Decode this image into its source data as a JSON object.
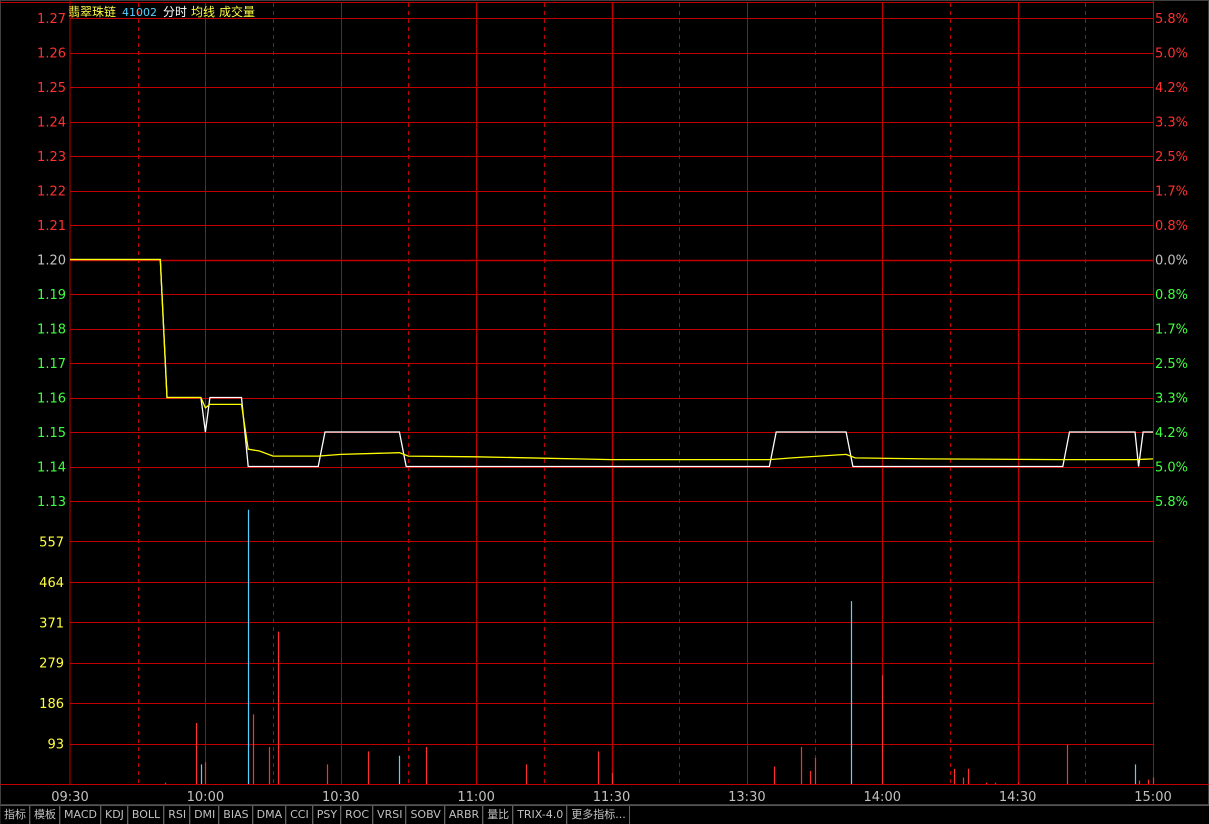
{
  "header": {
    "stock_name": "翡翠珠链",
    "stock_code": "41002",
    "label_timeshare": "分时",
    "label_avg": "均线",
    "label_volume": "成交量"
  },
  "colors": {
    "grid": "#c00000",
    "up": "#ff3030",
    "down": "#40ff40",
    "price_line": "#ffffff",
    "avg_line": "#ffff00",
    "vol_up": "#ff3030",
    "vol_down": "#54d2ff",
    "vol_label": "#ffff40",
    "axis_text": "#c0c0c0"
  },
  "tabs": [
    "指标",
    "模板",
    "MACD",
    "KDJ",
    "BOLL",
    "RSI",
    "DMI",
    "BIAS",
    "DMA",
    "CCI",
    "PSY",
    "ROC",
    "VRSI",
    "SOBV",
    "ARBR",
    "量比",
    "TRIX-4.0",
    "更多指标..."
  ],
  "chart_data": {
    "type": "line",
    "prev_close": 1.2,
    "price_axis": {
      "ticks": [
        "1.27",
        "1.26",
        "1.25",
        "1.24",
        "1.23",
        "1.22",
        "1.21",
        "1.20",
        "1.19",
        "1.18",
        "1.17",
        "1.16",
        "1.15",
        "1.14",
        "1.13"
      ],
      "ylim": [
        1.13,
        1.27
      ]
    },
    "pct_axis": {
      "ticks": [
        "5.8%",
        "5.0%",
        "4.2%",
        "3.3%",
        "2.5%",
        "1.7%",
        "0.8%",
        "0.0%",
        "0.8%",
        "1.7%",
        "2.5%",
        "3.3%",
        "4.2%",
        "5.0%",
        "5.8%"
      ]
    },
    "volume_axis": {
      "ticks": [
        "557",
        "464",
        "371",
        "279",
        "186",
        "93"
      ],
      "ylim": [
        0,
        650
      ]
    },
    "x_ticks": [
      "09:30",
      "10:00",
      "10:30",
      "11:00",
      "11:30",
      "13:30",
      "14:00",
      "14:30",
      "15:00"
    ],
    "x_range_minutes": [
      0,
      240
    ],
    "series": [
      {
        "role": "price",
        "points": [
          [
            0,
            1.2
          ],
          [
            20,
            1.2
          ],
          [
            21.5,
            1.16
          ],
          [
            29,
            1.16
          ],
          [
            30,
            1.15
          ],
          [
            31,
            1.16
          ],
          [
            38,
            1.16
          ],
          [
            39.5,
            1.14
          ],
          [
            55,
            1.14
          ],
          [
            56.5,
            1.15
          ],
          [
            73,
            1.15
          ],
          [
            74.5,
            1.14
          ],
          [
            155,
            1.14
          ],
          [
            156.5,
            1.15
          ],
          [
            172,
            1.15
          ],
          [
            173.5,
            1.14
          ],
          [
            220,
            1.14
          ],
          [
            221.5,
            1.15
          ],
          [
            236,
            1.15
          ],
          [
            236.8,
            1.14
          ],
          [
            237.8,
            1.15
          ],
          [
            240,
            1.15
          ]
        ]
      },
      {
        "role": "avg",
        "points": [
          [
            0,
            1.2
          ],
          [
            20,
            1.2
          ],
          [
            21.5,
            1.16
          ],
          [
            29,
            1.16
          ],
          [
            30,
            1.157
          ],
          [
            31,
            1.158
          ],
          [
            38,
            1.158
          ],
          [
            39.5,
            1.145
          ],
          [
            42,
            1.1445
          ],
          [
            45,
            1.143
          ],
          [
            55,
            1.143
          ],
          [
            60,
            1.1435
          ],
          [
            73,
            1.144
          ],
          [
            75,
            1.143
          ],
          [
            90,
            1.1428
          ],
          [
            120,
            1.142
          ],
          [
            155,
            1.142
          ],
          [
            160,
            1.1425
          ],
          [
            172,
            1.1435
          ],
          [
            174,
            1.1425
          ],
          [
            190,
            1.1422
          ],
          [
            220,
            1.142
          ],
          [
            236,
            1.142
          ],
          [
            240,
            1.1422
          ]
        ]
      }
    ],
    "volume": [
      {
        "t": 21,
        "v": 3,
        "c": "up"
      },
      {
        "t": 28,
        "v": 140,
        "c": "up"
      },
      {
        "t": 29,
        "v": 45,
        "c": "down"
      },
      {
        "t": 30,
        "v": 50,
        "c": "up"
      },
      {
        "t": 39.5,
        "v": 630,
        "c": "down"
      },
      {
        "t": 40.5,
        "v": 160,
        "c": "up"
      },
      {
        "t": 44,
        "v": 85,
        "c": "up"
      },
      {
        "t": 46,
        "v": 350,
        "c": "up"
      },
      {
        "t": 57,
        "v": 45,
        "c": "up"
      },
      {
        "t": 66,
        "v": 75,
        "c": "up"
      },
      {
        "t": 73,
        "v": 65,
        "c": "down"
      },
      {
        "t": 79,
        "v": 85,
        "c": "up"
      },
      {
        "t": 101,
        "v": 45,
        "c": "up"
      },
      {
        "t": 117,
        "v": 75,
        "c": "up"
      },
      {
        "t": 120,
        "v": 25,
        "c": "up"
      },
      {
        "t": 156,
        "v": 40,
        "c": "up"
      },
      {
        "t": 162,
        "v": 85,
        "c": "up"
      },
      {
        "t": 164,
        "v": 30,
        "c": "up"
      },
      {
        "t": 165,
        "v": 60,
        "c": "up"
      },
      {
        "t": 173,
        "v": 420,
        "c": "down"
      },
      {
        "t": 180,
        "v": 250,
        "c": "up"
      },
      {
        "t": 196,
        "v": 35,
        "c": "up"
      },
      {
        "t": 198,
        "v": 15,
        "c": "up"
      },
      {
        "t": 199,
        "v": 35,
        "c": "up"
      },
      {
        "t": 203,
        "v": 3,
        "c": "up"
      },
      {
        "t": 205,
        "v": 3,
        "c": "up"
      },
      {
        "t": 210,
        "v": 3,
        "c": "up"
      },
      {
        "t": 221,
        "v": 90,
        "c": "up"
      },
      {
        "t": 236,
        "v": 45,
        "c": "down"
      },
      {
        "t": 237,
        "v": 8,
        "c": "up"
      },
      {
        "t": 239,
        "v": 10,
        "c": "up"
      },
      {
        "t": 240,
        "v": 15,
        "c": "up"
      }
    ]
  }
}
